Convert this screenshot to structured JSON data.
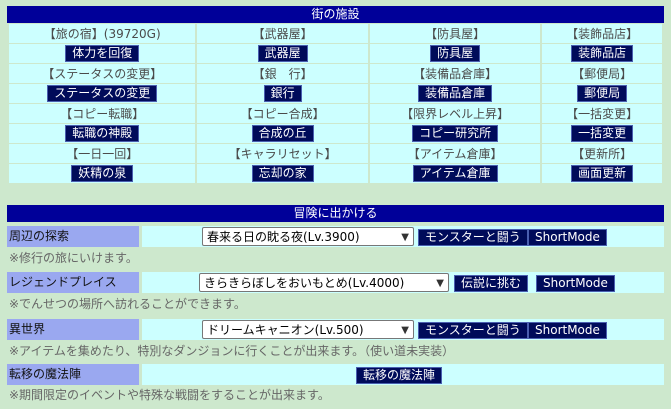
{
  "facilities": {
    "title": "街の施設",
    "rows": [
      [
        {
          "label": "【旅の宿】(39720G)",
          "button": "体力を回復"
        },
        {
          "label": "【武器屋】",
          "button": "武器屋"
        },
        {
          "label": "【防具屋】",
          "button": "防具屋"
        },
        {
          "label": "【装飾品店】",
          "button": "装飾品店"
        }
      ],
      [
        {
          "label": "【ステータスの変更】",
          "button": "ステータスの変更"
        },
        {
          "label": "【銀　行】",
          "button": "銀行"
        },
        {
          "label": "【装備品倉庫】",
          "button": "装備品倉庫"
        },
        {
          "label": "【郵便局】",
          "button": "郵便局"
        }
      ],
      [
        {
          "label": "【コピー転職】",
          "button": "転職の神殿"
        },
        {
          "label": "【コピー合成】",
          "button": "合成の丘"
        },
        {
          "label": "【限界レベル上昇】",
          "button": "コピー研究所"
        },
        {
          "label": "【一括変更】",
          "button": "一括変更"
        }
      ],
      [
        {
          "label": "【一日一回】",
          "button": "妖精の泉"
        },
        {
          "label": "【キャラリセット】",
          "button": "忘却の家"
        },
        {
          "label": "【アイテム倉庫】",
          "button": "アイテム倉庫"
        },
        {
          "label": "【更新所】",
          "button": "画面更新"
        }
      ]
    ]
  },
  "adventure": {
    "title": "冒険に出かける",
    "explore": {
      "label": "周辺の探索",
      "selected": "春来る日の眈る夜(Lv.3900)",
      "fight_button": "モンスターと闘う",
      "short_button": "ShortMode",
      "note": "※修行の旅にいけます。"
    },
    "legend": {
      "label": "レジェンドプレイス",
      "selected": "きらきらぼしをおいもとめ(Lv.4000)",
      "fight_button": "伝説に挑む",
      "short_button": "ShortMode",
      "note": "※でんせつの場所へ訪れることができます。"
    },
    "otherworld": {
      "label": "異世界",
      "selected": "ドリームキャニオン(Lv.500)",
      "fight_button": "モンスターと闘う",
      "short_button": "ShortMode",
      "note": "※アイテムを集めたり、特別なダンジョンに行くことが出来ます。（使い道未実装）"
    },
    "teleport": {
      "label": "転移の魔法陣",
      "button": "転移の魔法陣",
      "note": "※期間限定のイベントや特殊な戦闘をすることが出来ます。"
    }
  }
}
